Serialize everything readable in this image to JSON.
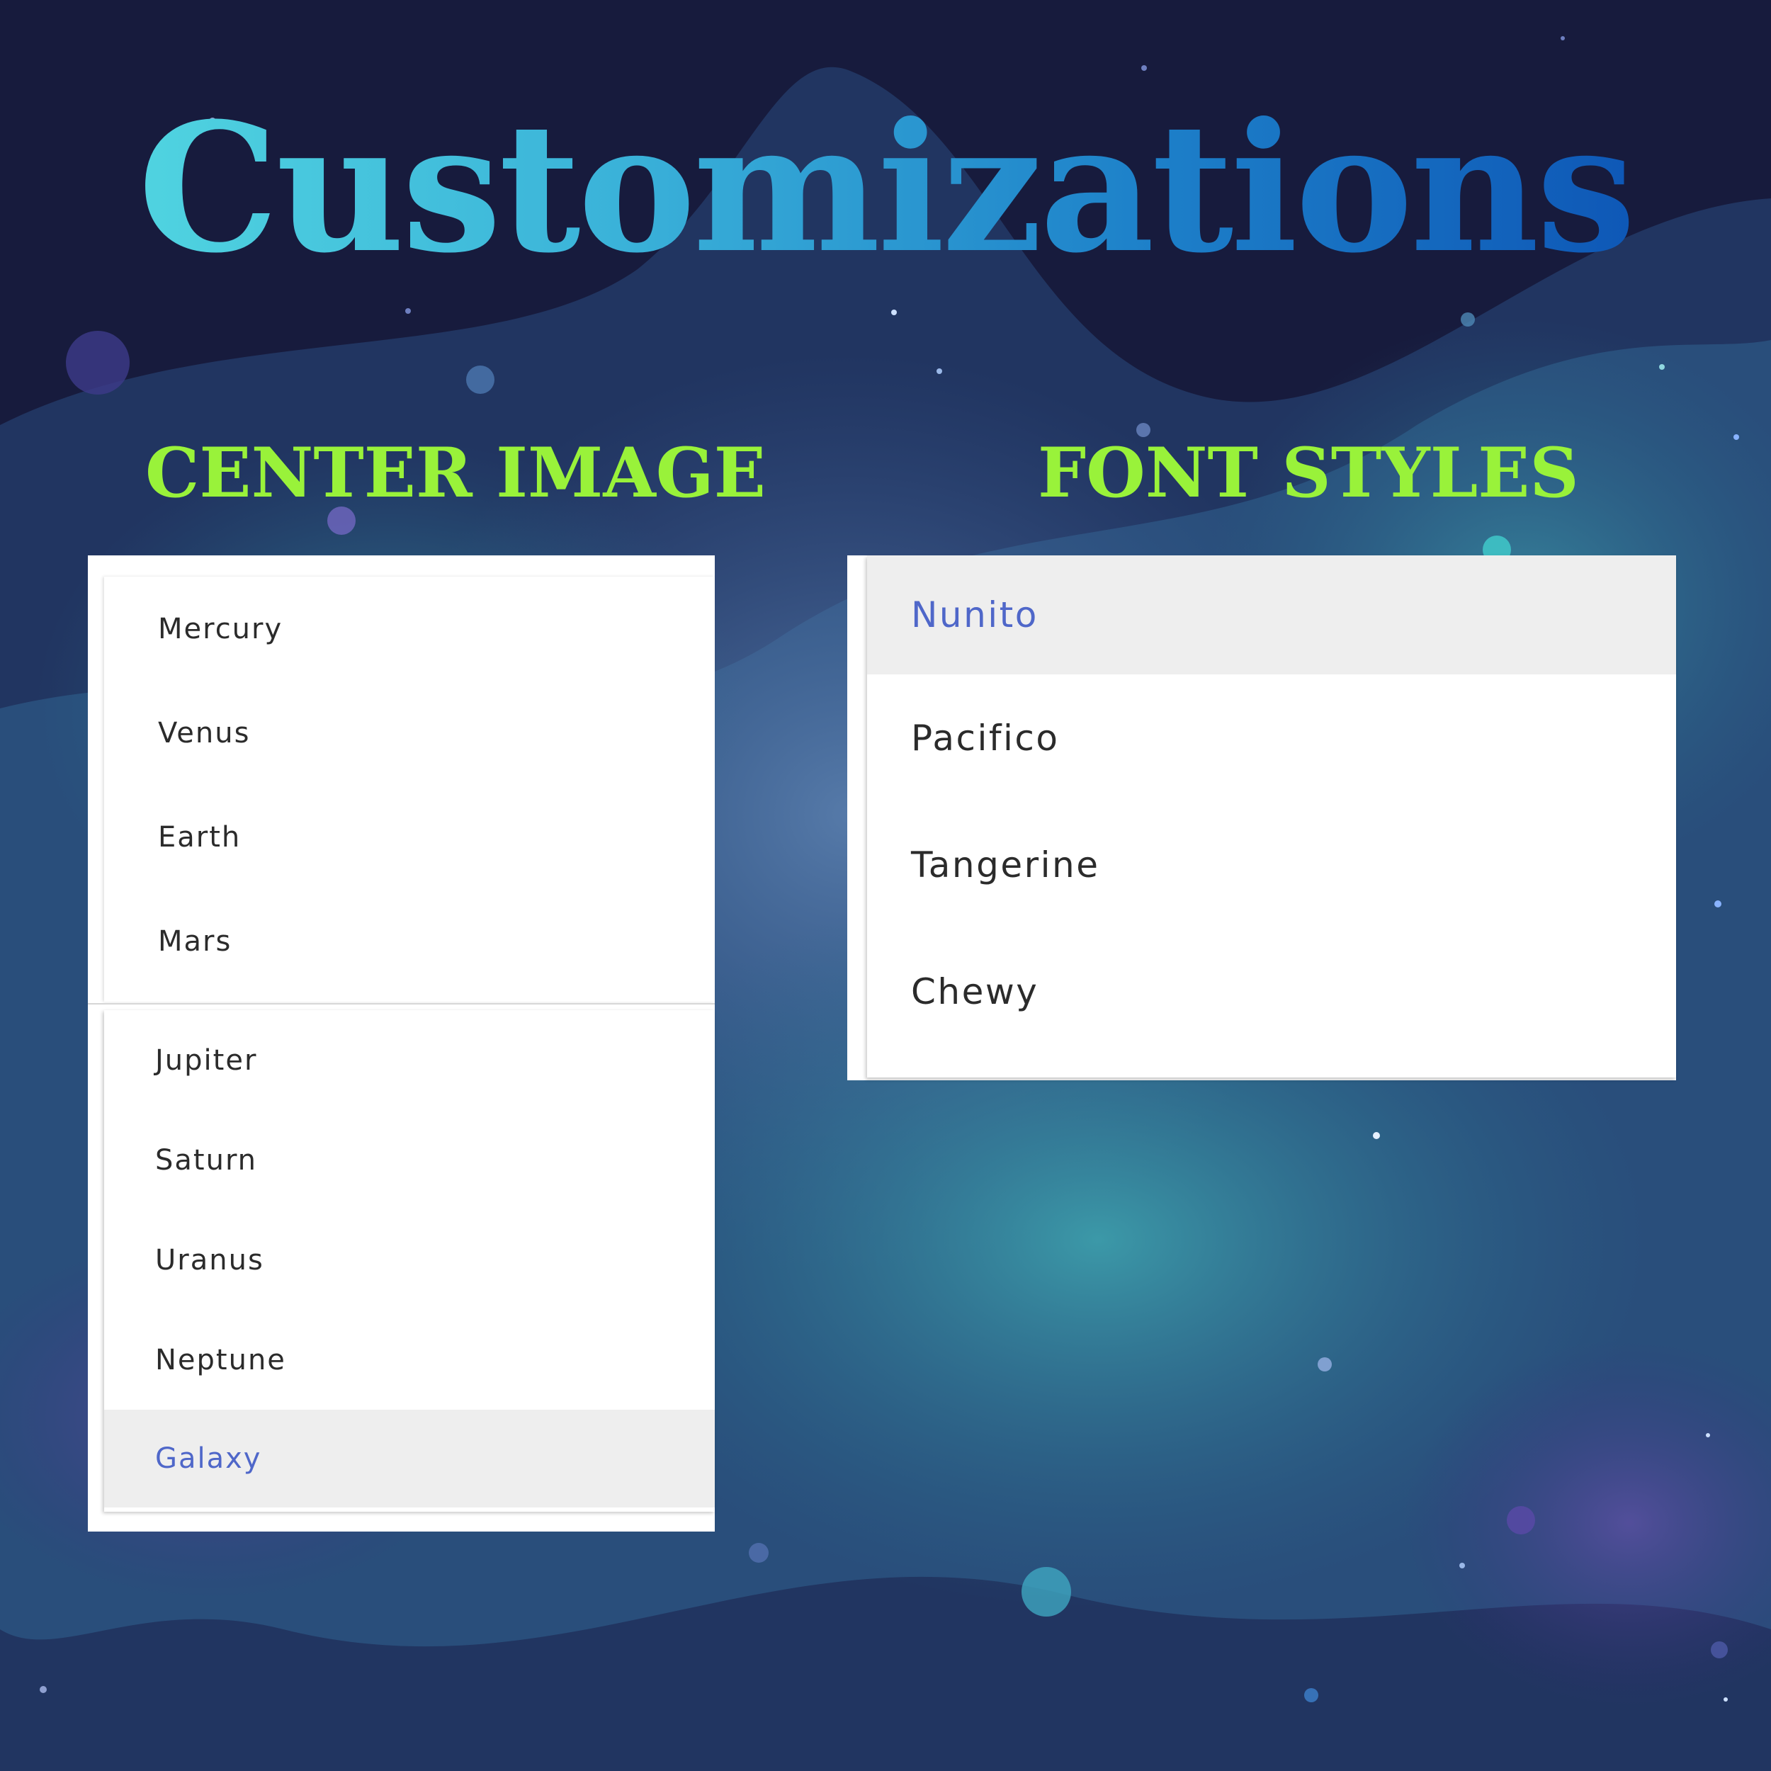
{
  "header": {
    "title": "Customizations"
  },
  "center_image": {
    "heading": "CENTER IMAGE",
    "options_top": [
      "Mercury",
      "Venus",
      "Earth",
      "Mars"
    ],
    "options_bottom": [
      "Jupiter",
      "Saturn",
      "Uranus",
      "Neptune",
      "Galaxy"
    ],
    "selected": "Galaxy"
  },
  "font_styles": {
    "heading": "FONT STYLES",
    "options": [
      "Nunito",
      "Pacifico",
      "Tangerine",
      "Chewy"
    ],
    "selected": "Nunito"
  },
  "colors": {
    "heading": "#99f23a",
    "selected_text": "#4f67c9",
    "item_text": "#2b2b2b",
    "selected_bg": "#eeeeee",
    "title_gradient": [
      "#56dde2",
      "#0a4cb1"
    ]
  }
}
